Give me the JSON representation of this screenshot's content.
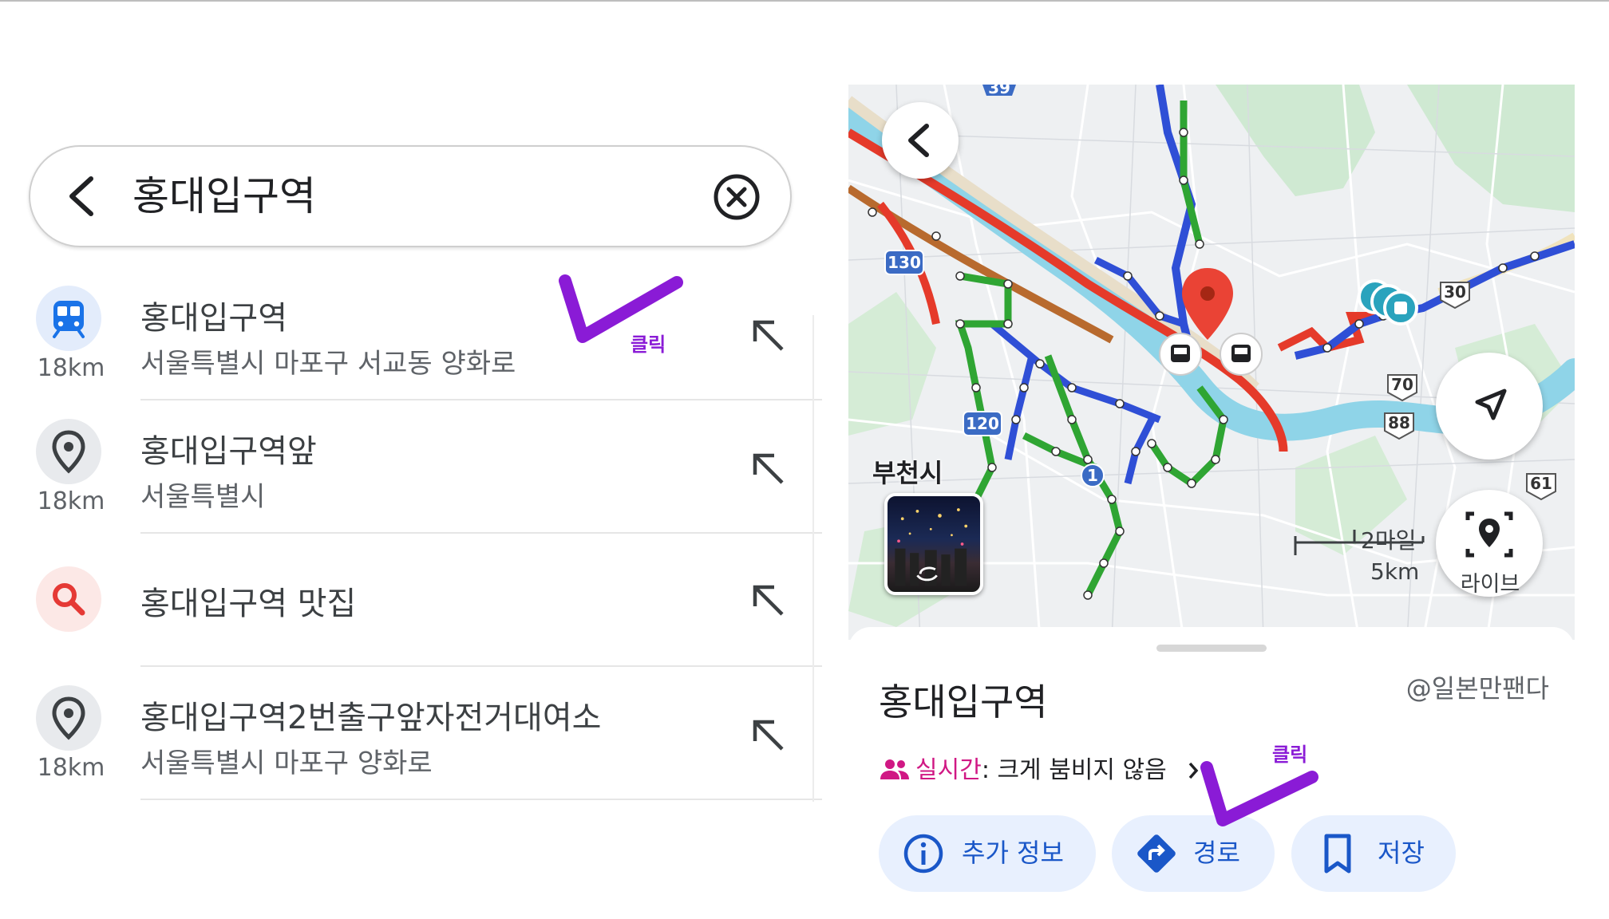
{
  "search": {
    "query": "홍대입구역",
    "back_icon": "chevron-left-icon",
    "clear_icon": "close-circle-icon"
  },
  "results": [
    {
      "title": "홍대입구역",
      "subtitle": "서울특별시 마포구 서교동 양화로",
      "distance": "18km",
      "icon": "subway-icon"
    },
    {
      "title": "홍대입구역앞",
      "subtitle": "서울특별시",
      "distance": "18km",
      "icon": "location-pin-icon"
    },
    {
      "title": "홍대입구역 맛집",
      "subtitle": "",
      "distance": "",
      "icon": "search-icon"
    },
    {
      "title": "홍대입구역2번출구앞자전거대여소",
      "subtitle": "서울특별시 마포구 양화로",
      "distance": "18km",
      "icon": "location-pin-icon"
    }
  ],
  "map": {
    "place_label": "부천시",
    "road_badges": [
      "39",
      "130",
      "120",
      "1",
      "30",
      "70",
      "88",
      "61"
    ],
    "scale": {
      "top": "2마일",
      "bottom": "5km"
    },
    "live_button_label": "라이브"
  },
  "sheet": {
    "place_name": "홍대입구역",
    "credit": "@일본만팬다",
    "live_label": "실시간",
    "live_status": ": 크게 붐비지 않음",
    "buttons": [
      {
        "label": "추가 정보",
        "icon": "info-icon"
      },
      {
        "label": "경로",
        "icon": "directions-icon"
      },
      {
        "label": "저장",
        "icon": "bookmark-icon"
      }
    ]
  },
  "annotations": {
    "click_label": "클릭"
  },
  "colors": {
    "accent": "#1a73e8",
    "chip_bg": "#e8f0fe",
    "live_red": "#d01884",
    "annotation_purple": "#8a1bd6"
  }
}
